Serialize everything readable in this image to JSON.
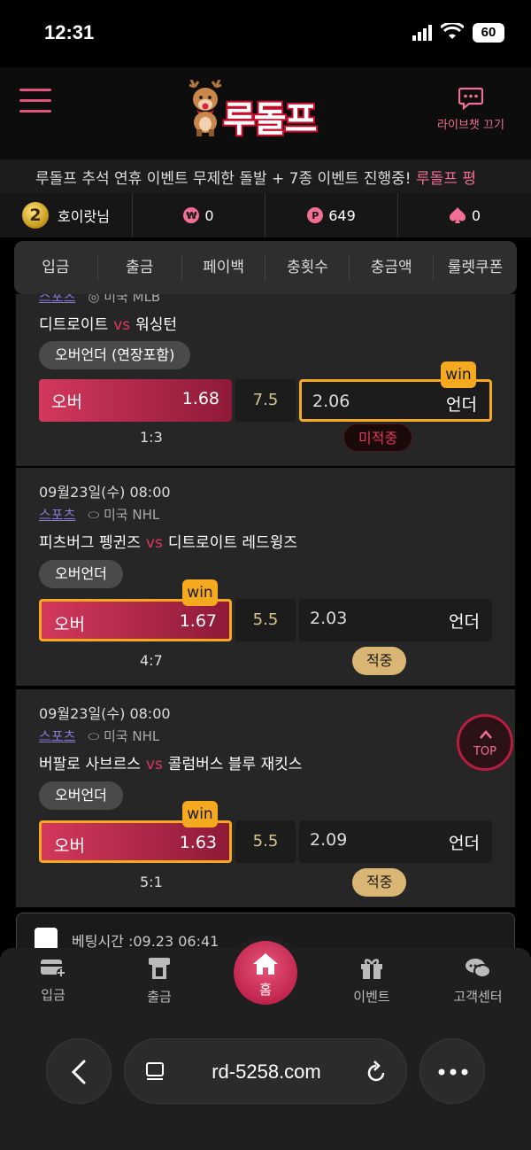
{
  "status_bar": {
    "time": "12:31",
    "battery": "60"
  },
  "header": {
    "logo_text": "루돌프",
    "livechat_label": "라이브챗 끄기"
  },
  "marquee": {
    "text_prefix": "루돌프 추석 연휴 이벤트 무제한 돌발 + 7종 이벤트 진행중! ",
    "text_highlight": "루돌프 평"
  },
  "user": {
    "level": "2",
    "name": "호이랏님",
    "cash_icon": "₩",
    "cash": "0",
    "point_icon": "P",
    "points": "649",
    "spade_value": "0"
  },
  "tabs": [
    "입금",
    "출금",
    "페이백",
    "충횟수",
    "충금액",
    "룰렛쿠폰"
  ],
  "bets": [
    {
      "date": "",
      "category": "스포츠",
      "league": "미국 MLB",
      "home": "디트로이트",
      "vs": "vs",
      "away": "워싱턴",
      "market": "오버언더 (연장포함)",
      "over_label": "오버",
      "over_odd": "1.68",
      "line": "7.5",
      "under_odd": "2.06",
      "under_label": "언더",
      "win_side": "under",
      "win_label": "win",
      "score": "1:3",
      "result": "미적중"
    },
    {
      "date": "09월23일(수) 08:00",
      "category": "스포츠",
      "league": "미국 NHL",
      "home": "피츠버그 펭귄즈",
      "vs": "vs",
      "away": "디트로이트 레드윙즈",
      "market": "오버언더",
      "over_label": "오버",
      "over_odd": "1.67",
      "line": "5.5",
      "under_odd": "2.03",
      "under_label": "언더",
      "win_side": "over",
      "win_label": "win",
      "score": "4:7",
      "result": "적중"
    },
    {
      "date": "09월23일(수) 08:00",
      "category": "스포츠",
      "league": "미국 NHL",
      "home": "버팔로 사브르스",
      "vs": "vs",
      "away": "콜럼버스 블루 재킷스",
      "market": "오버언더",
      "over_label": "오버",
      "over_odd": "1.63",
      "line": "5.5",
      "under_odd": "2.09",
      "under_label": "언더",
      "win_side": "over",
      "win_label": "win",
      "score": "5:1",
      "result": "적중"
    }
  ],
  "bet_time": "베팅시간 :09.23 06:41",
  "top_button": "TOP",
  "bottom_nav": {
    "deposit": "입금",
    "withdraw": "출금",
    "home": "홈",
    "event": "이벤트",
    "support": "고객센터"
  },
  "browser": {
    "url": "rd-5258.com"
  },
  "colors": {
    "accent": "#f06f93",
    "over_red": "#d3385c",
    "win_gold": "#f4a91e",
    "hit_badge": "#d9b673"
  }
}
